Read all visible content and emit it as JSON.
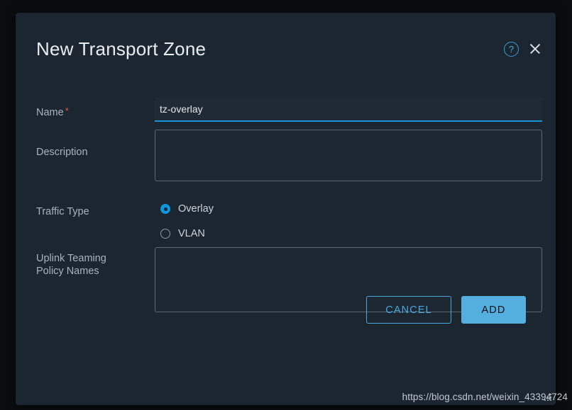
{
  "dialog": {
    "title": "New Transport Zone",
    "help_icon": "help-circle-icon",
    "close_icon": "close-icon"
  },
  "fields": {
    "name": {
      "label": "Name",
      "required_mark": "*",
      "value": "tz-overlay",
      "placeholder": ""
    },
    "description": {
      "label": "Description",
      "value": "",
      "placeholder": ""
    },
    "traffic_type": {
      "label": "Traffic Type",
      "selected": "Overlay",
      "options": [
        {
          "label": "Overlay",
          "selected": true
        },
        {
          "label": "VLAN",
          "selected": false
        }
      ]
    },
    "uplink_teaming": {
      "label_line1": "Uplink Teaming",
      "label_line2": "Policy Names",
      "value": "",
      "placeholder": ""
    }
  },
  "footer": {
    "cancel_label": "CANCEL",
    "add_label": "ADD"
  },
  "watermark": {
    "text": "https://blog.csdn.net/weixin_43394724"
  },
  "colors": {
    "accent_blue": "#1694d4",
    "button_blue": "#54aede",
    "link_blue": "#49a7dd",
    "required_red": "#e8583f",
    "modal_bg": "#1b2630",
    "backdrop": "#0a0c0e"
  }
}
